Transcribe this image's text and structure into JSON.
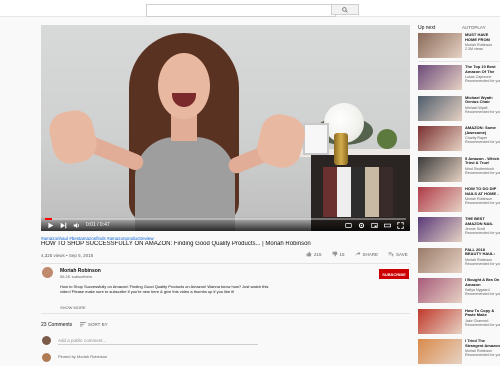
{
  "search": {
    "placeholder": ""
  },
  "video": {
    "current_time": "0:01",
    "duration": "0:47",
    "progress": 0.02
  },
  "info": {
    "hashtags": "#amazonhaul #bestamazonfinds #amazonproductreview",
    "title": "HOW TO SHOP SUCCESSFULLY ON AMAZON: Finding Good Quality Products... | Moriah Robinson",
    "meta": "4,325 views • Sep 5, 2018",
    "likes": "215",
    "dislikes": "15",
    "share": "SHARE",
    "save": "SAVE"
  },
  "channel": {
    "name": "Moriah Robinson",
    "subs": "56.2K subscribers",
    "subscribe": "SUBSCRIBE",
    "description": "How to Shop Successfully on Amazon! Finding Good Quality Products on Amazon! Wanna know how? Just watch this video! Please make sure to subscribe if you're new here & give this video a thumbs up if you like it!",
    "show_more": "SHOW MORE"
  },
  "comments": {
    "count": "23 Comments",
    "sort": "SORT BY",
    "placeholder": "Add a public comment...",
    "first_author": "Pinned by Moriah Robinson"
  },
  "sidebar": {
    "upnext": "Up next",
    "autoplay": "AUTOPLAY",
    "items": [
      {
        "title": "MUST HAVE HOME FROM AMAZON!",
        "channel": "Moriah Robinson",
        "views": "2.3M views",
        "duration": "",
        "color": "#8a6b5a"
      },
      {
        "title": "The Top 10 Best Amazon Of The Decade",
        "channel": "Lukas Capreone",
        "views": "Recommended for you",
        "duration": "",
        "color": "#6c4a7a"
      },
      {
        "title": "Michael Wyatt: Genius Chair",
        "channel": "Michael Wyatt",
        "views": "Recommended for you",
        "duration": "",
        "color": "#4f5d6b"
      },
      {
        "title": "AMAZON: Some (Awesome) Products",
        "channel": "Charity Raper",
        "views": "Recommended for you",
        "duration": "",
        "color": "#7a2f2f"
      },
      {
        "title": "5 Amazon - Which Tried & True!",
        "channel": "Mind Shutterblush",
        "views": "Recommended for you",
        "duration": "",
        "color": "#3b3b3b"
      },
      {
        "title": "HOW TO DO DIP NAILS AT HOME - SALON RESULTS!",
        "channel": "Moriah Robinson",
        "views": "Recommended for you",
        "duration": "",
        "color": "#b03a48"
      },
      {
        "title": "THE BEST AMAZON NAIL SUPPLY DIY",
        "channel": "Jennie Scott",
        "views": "Recommended for you",
        "duration": "",
        "color": "#5a3a7a"
      },
      {
        "title": "FALL 2018 BEAUTY HAUL: What Products I Love",
        "channel": "Moriah Robinson",
        "views": "Recommended for you",
        "duration": "",
        "color": "#9a7b6a"
      },
      {
        "title": "I Bought A Bra On Amazon Customer Response...",
        "channel": "Safiya Nygaard",
        "views": "Recommended for you",
        "duration": "",
        "color": "#a85b7a"
      },
      {
        "title": "How To Copy & Paste Make $100/Day",
        "channel": "Jake Charmed",
        "views": "Recommended for you",
        "duration": "",
        "color": "#c0392b"
      },
      {
        "title": "I Tried The Strangest Amazon - The Truth About",
        "channel": "Moriah Robinson",
        "views": "Recommended for you",
        "duration": "",
        "color": "#d98a4a"
      }
    ]
  }
}
